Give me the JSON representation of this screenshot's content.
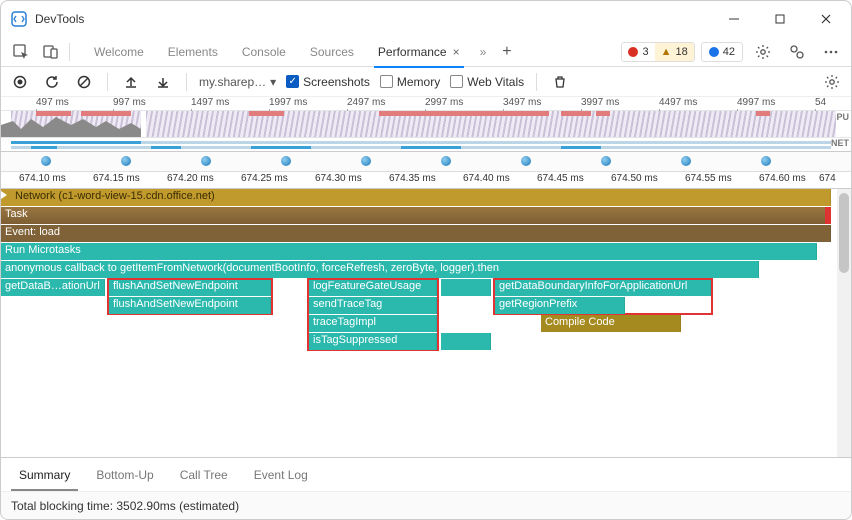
{
  "window": {
    "title": "DevTools"
  },
  "tabstrip": {
    "tabs": [
      "Welcome",
      "Elements",
      "Console",
      "Sources",
      "Performance"
    ],
    "active": "Performance",
    "close_glyph": "×",
    "overflow_glyph": "»",
    "plus_glyph": "+"
  },
  "issues": {
    "errors": "3",
    "warnings": "18",
    "messages": "42"
  },
  "perf_toolbar": {
    "profile_selector": "my.sharep…",
    "screenshots_label": "Screenshots",
    "screenshots_checked": true,
    "memory_label": "Memory",
    "memory_checked": false,
    "webvitals_label": "Web Vitals",
    "webvitals_checked": false
  },
  "overview": {
    "ticks": [
      "497 ms",
      "997 ms",
      "1497 ms",
      "1997 ms",
      "2497 ms",
      "2997 ms",
      "3497 ms",
      "3997 ms",
      "4497 ms",
      "4997 ms",
      "54"
    ],
    "cpu_label": "CPU",
    "net_label": "NET"
  },
  "fine_ruler": {
    "ticks": [
      "674.10 ms",
      "674.15 ms",
      "674.20 ms",
      "674.25 ms",
      "674.30 ms",
      "674.35 ms",
      "674.40 ms",
      "674.45 ms",
      "674.50 ms",
      "674.55 ms",
      "674.60 ms",
      "674"
    ]
  },
  "network_row": {
    "prefix": "Network",
    "suffix": "(c1-word-view-15.cdn.office.net)"
  },
  "flame": {
    "task": "Task",
    "event_load": "Event: load",
    "run_microtasks": "Run Microtasks",
    "anon_cb": "anonymous callback to getItemFromNetwork(documentBootInfo, forceRefresh, zeroByte, logger).then",
    "get_data_b": "getDataB…ationUrl",
    "flush1": "flushAndSetNewEndpoint",
    "flush2": "flushAndSetNewEndpoint",
    "log_feature": "logFeatureGateUsage",
    "send_trace": "sendTraceTag",
    "trace_impl": "traceTagImpl",
    "is_tag_supp": "isTagSuppressed",
    "get_boundary": "getDataBoundaryInfoForApplicationUrl",
    "get_region": "getRegionPrefix",
    "compile_code": "Compile Code"
  },
  "bottom_tabs": {
    "tabs": [
      "Summary",
      "Bottom-Up",
      "Call Tree",
      "Event Log"
    ],
    "active": "Summary"
  },
  "status": {
    "text": "Total blocking time: 3502.90ms (estimated)"
  }
}
